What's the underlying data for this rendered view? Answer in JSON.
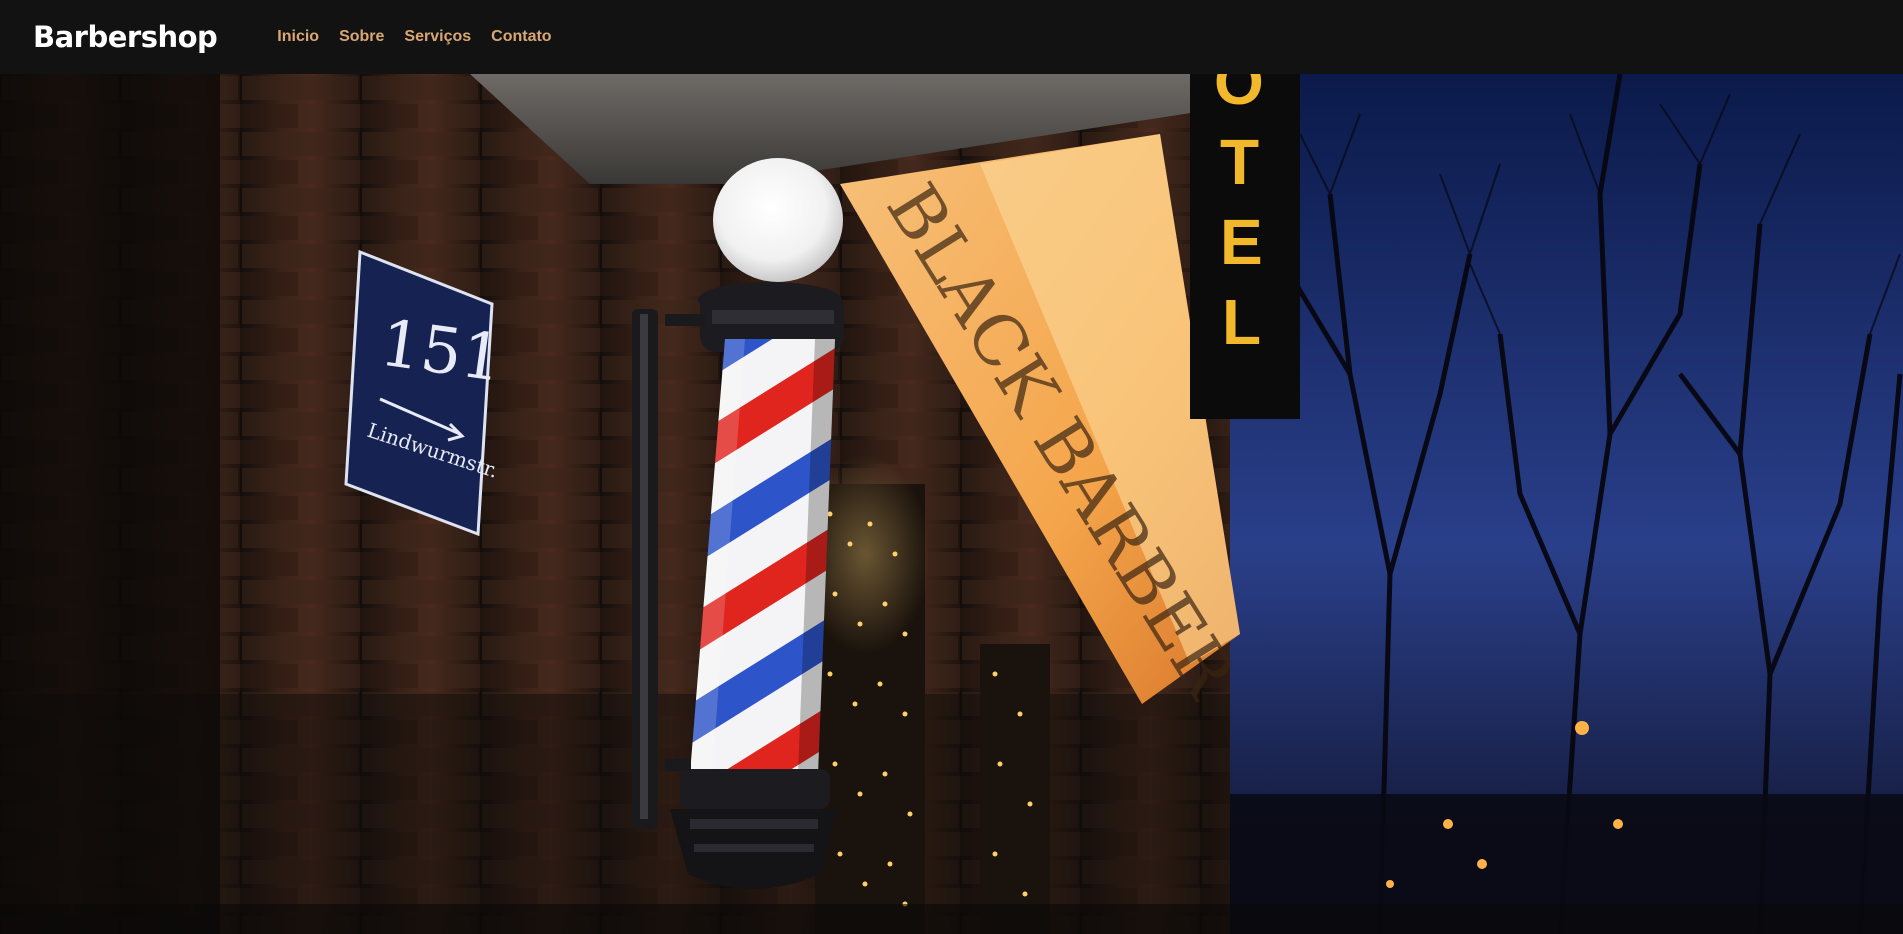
{
  "navbar": {
    "brand": "Barbershop",
    "links": [
      {
        "label": "Inicio"
      },
      {
        "label": "Sobre"
      },
      {
        "label": "Serviços"
      },
      {
        "label": "Contato"
      }
    ]
  },
  "hero": {
    "image": {
      "house_number": "151",
      "street_sign": "Lindwurmstr.",
      "hotel_letters": [
        "O",
        "T",
        "E",
        "L"
      ],
      "shop_sign": "BLACK BARBER"
    }
  },
  "colors": {
    "nav_bg": "#121212",
    "brand": "#ffffff",
    "nav_link": "#d9a774"
  }
}
